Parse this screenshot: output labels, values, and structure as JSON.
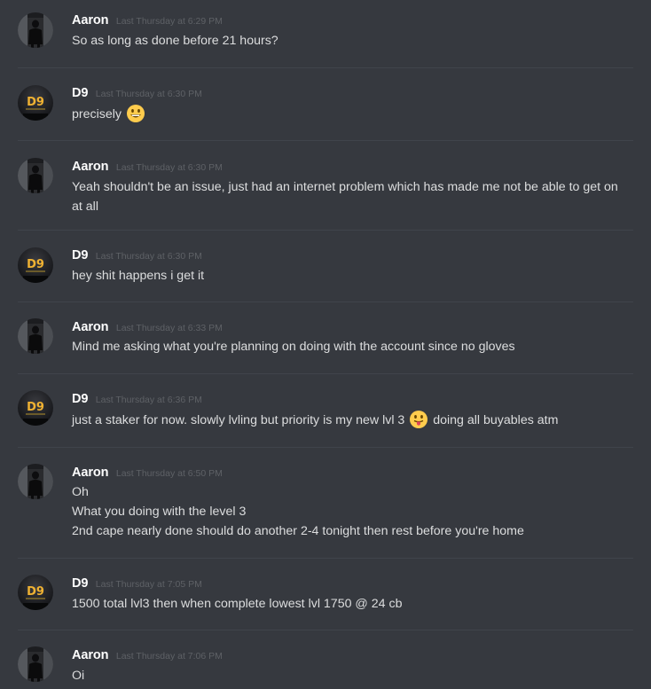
{
  "messages": [
    {
      "author": "Aaron",
      "avatar": "aaron-avatar",
      "timestamp": "Last Thursday at 6:29 PM",
      "lines": [
        "So as long as done before 21 hours?"
      ]
    },
    {
      "author": "D9",
      "avatar": "d9-avatar",
      "timestamp": "Last Thursday at 6:30 PM",
      "text": "precisely",
      "emoji": "grinning-face-emoji"
    },
    {
      "author": "Aaron",
      "avatar": "aaron-avatar",
      "timestamp": "Last Thursday at 6:30 PM",
      "lines": [
        "Yeah shouldn't be an issue, just had an internet problem which has made me not be able to get on at all"
      ]
    },
    {
      "author": "D9",
      "avatar": "d9-avatar",
      "timestamp": "Last Thursday at 6:30 PM",
      "lines": [
        "hey shit happens i get it"
      ]
    },
    {
      "author": "Aaron",
      "avatar": "aaron-avatar",
      "timestamp": "Last Thursday at 6:33 PM",
      "lines": [
        "Mind me asking what you're planning on doing with the account since no gloves"
      ]
    },
    {
      "author": "D9",
      "avatar": "d9-avatar",
      "timestamp": "Last Thursday at 6:36 PM",
      "text_before": "just a staker for now. slowly lvling but priority is my new lvl 3",
      "emoji": "tongue-out-face-emoji",
      "text_after": "doing all buyables atm"
    },
    {
      "author": "Aaron",
      "avatar": "aaron-avatar",
      "timestamp": "Last Thursday at 6:50 PM",
      "lines": [
        "Oh",
        "What you doing with the level 3",
        "2nd cape nearly done should do another 2-4 tonight then rest before you're home"
      ]
    },
    {
      "author": "D9",
      "avatar": "d9-avatar",
      "timestamp": "Last Thursday at 7:05 PM",
      "lines": [
        "1500 total lvl3 then when complete lowest lvl 1750 @ 24 cb"
      ]
    },
    {
      "author": "Aaron",
      "avatar": "aaron-avatar",
      "timestamp": "Last Thursday at 7:06 PM",
      "lines": [
        "Oi"
      ]
    }
  ],
  "colors": {
    "background": "#36393f",
    "divider": "#40444b",
    "author": "#ffffff",
    "timestamp": "#5e6166",
    "text": "#dcddde",
    "d9_logo": "#f0b232"
  }
}
